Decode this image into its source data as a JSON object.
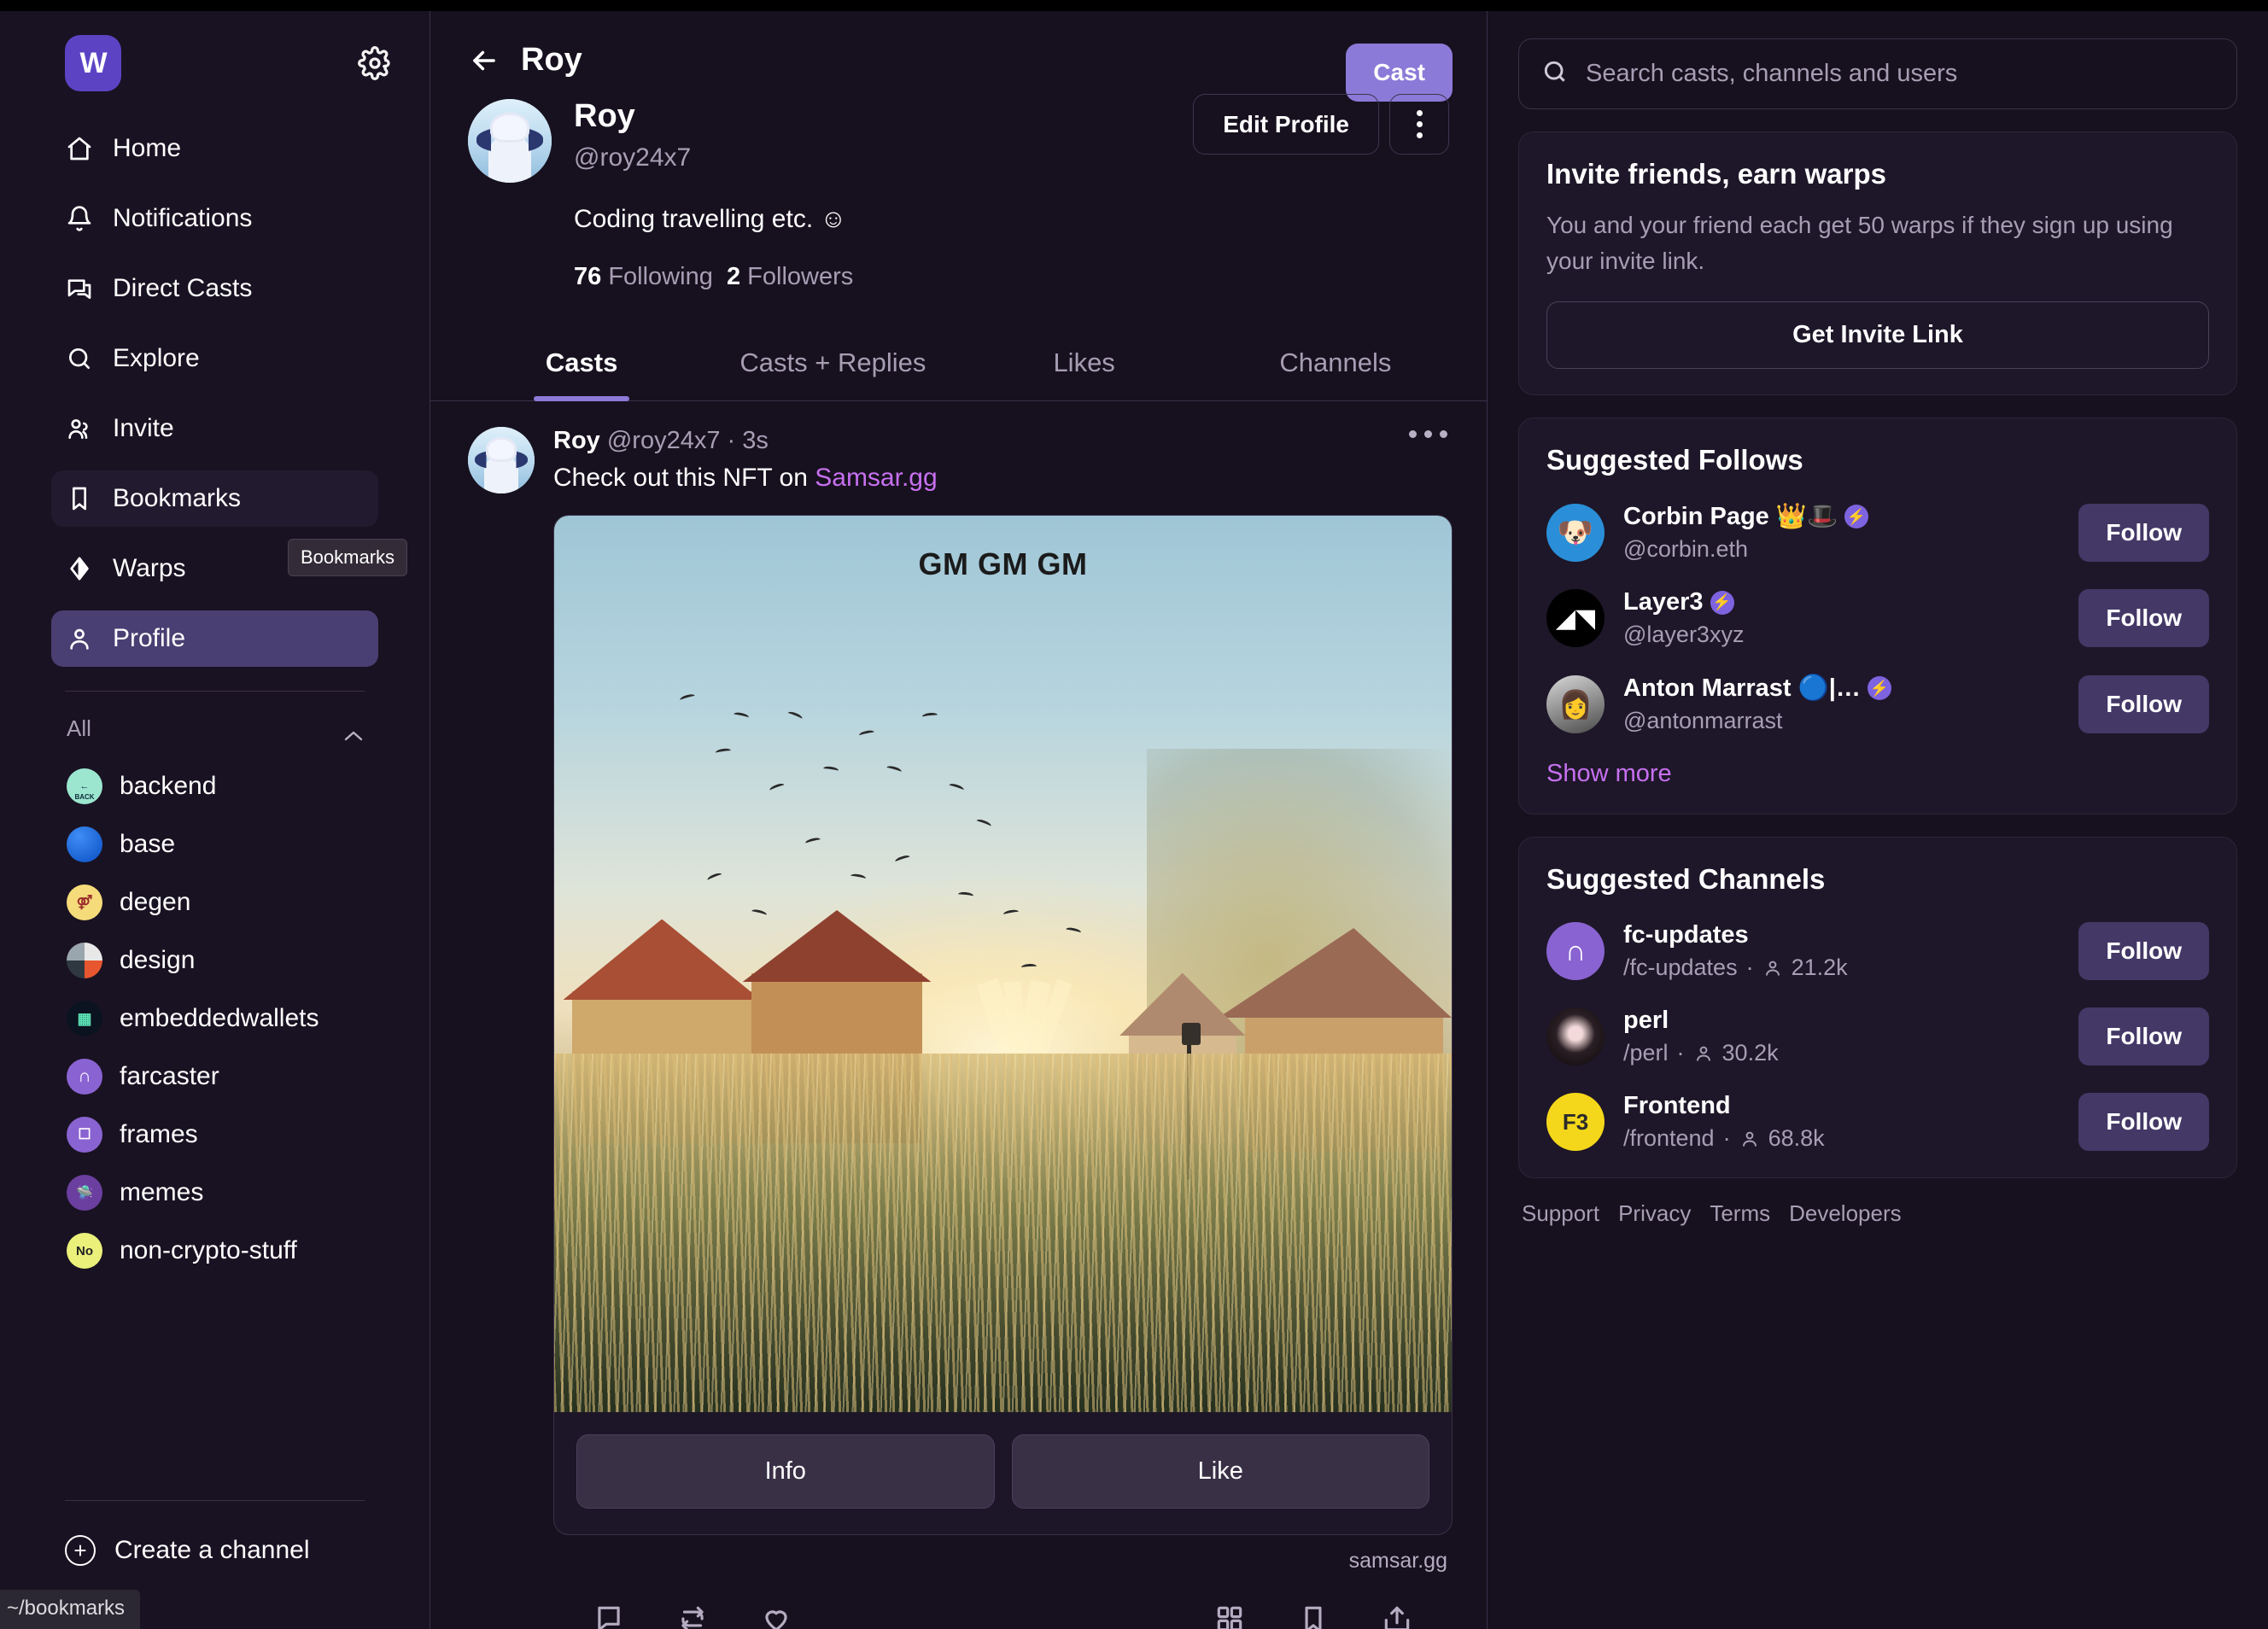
{
  "app": {
    "logo_letter": "W",
    "gear_icon": "gear-icon"
  },
  "sidebar": {
    "nav": [
      {
        "label": "Home",
        "icon": "home-icon",
        "state": "default"
      },
      {
        "label": "Notifications",
        "icon": "bell-icon",
        "state": "default"
      },
      {
        "label": "Direct Casts",
        "icon": "chat-icon",
        "state": "default"
      },
      {
        "label": "Explore",
        "icon": "search-icon",
        "state": "default"
      },
      {
        "label": "Invite",
        "icon": "users-icon",
        "state": "default"
      },
      {
        "label": "Bookmarks",
        "icon": "bookmark-icon",
        "state": "soft"
      },
      {
        "label": "Warps",
        "icon": "warp-diamond-icon",
        "state": "default"
      },
      {
        "label": "Profile",
        "icon": "person-icon",
        "state": "active"
      }
    ],
    "tooltip": "Bookmarks",
    "group_label": "All",
    "channels": [
      {
        "label": "backend",
        "avatar_text": "BACK",
        "avatar_color": "#9ce6cf",
        "text_color": "#124",
        "kind": "back-arrow"
      },
      {
        "label": "base",
        "avatar_text": "",
        "avatar_color": "#1164e0",
        "text_color": "#fff",
        "kind": "solid"
      },
      {
        "label": "degen",
        "avatar_text": "",
        "avatar_color": "#f5db7a",
        "text_color": "#333",
        "kind": "hat"
      },
      {
        "label": "design",
        "avatar_text": "",
        "avatar_color": "#d8d8d8",
        "text_color": "#333",
        "kind": "palette"
      },
      {
        "label": "embeddedwallets",
        "avatar_text": "",
        "avatar_color": "#0b1320",
        "text_color": "#7fe",
        "kind": "cube"
      },
      {
        "label": "farcaster",
        "avatar_text": "n",
        "avatar_color": "#8a63d2",
        "text_color": "#fff",
        "kind": "arch"
      },
      {
        "label": "frames",
        "avatar_text": "",
        "avatar_color": "#8a63d2",
        "text_color": "#fff",
        "kind": "square"
      },
      {
        "label": "memes",
        "avatar_text": "",
        "avatar_color": "#6b3fa0",
        "text_color": "#fff",
        "kind": "ufo"
      },
      {
        "label": "non-crypto-stuff",
        "avatar_text": "No",
        "avatar_color": "#eaf07a",
        "text_color": "#222",
        "kind": "text"
      }
    ],
    "create_channel": "Create a channel",
    "create_icon": "plus-circle-icon",
    "status_url": "~/bookmarks"
  },
  "center": {
    "header_title": "Roy",
    "back_icon": "back-arrow-icon",
    "cast_button": "Cast",
    "profile": {
      "display_name": "Roy",
      "handle": "@roy24x7",
      "bio": "Coding travelling etc. ☺",
      "following_count": "76",
      "following_label": "Following",
      "followers_count": "2",
      "followers_label": "Followers",
      "edit_button": "Edit Profile",
      "more_icon": "kebab-menu-icon"
    },
    "tabs": [
      {
        "label": "Casts",
        "active": true
      },
      {
        "label": "Casts + Replies",
        "active": false
      },
      {
        "label": "Likes",
        "active": false
      },
      {
        "label": "Channels",
        "active": false
      }
    ],
    "cast": {
      "author": "Roy",
      "handle": "@roy24x7",
      "separator": "·",
      "time": "3s",
      "text_before_link": "Check out this NFT on ",
      "link_text": "Samsar.gg",
      "more_icon": "ellipsis-icon",
      "frame": {
        "image_caption": "GM GM GM",
        "buttons": [
          "Info",
          "Like"
        ],
        "source": "samsar.gg"
      },
      "actions_left": [
        {
          "icon": "comment-icon"
        },
        {
          "icon": "recast-icon"
        },
        {
          "icon": "heart-icon"
        }
      ],
      "actions_right": [
        {
          "icon": "grid-icon"
        },
        {
          "icon": "bookmark-icon"
        },
        {
          "icon": "share-icon"
        }
      ]
    }
  },
  "right": {
    "search": {
      "placeholder": "Search casts, channels and users",
      "value": "",
      "icon": "search-icon"
    },
    "invite": {
      "title": "Invite friends, earn warps",
      "body": "You and your friend each get 50 warps if they sign up using your invite link.",
      "button": "Get Invite Link"
    },
    "suggested_follows": {
      "title": "Suggested Follows",
      "show_more": "Show more",
      "items": [
        {
          "name": "Corbin Page 👑🎩",
          "handle": "@corbin.eth",
          "verified": true,
          "button": "Follow",
          "avatar_color": "#2a8fd8",
          "avatar_glyph": "🐶"
        },
        {
          "name": "Layer3",
          "handle": "@layer3xyz",
          "verified": true,
          "button": "Follow",
          "avatar_color": "#000000",
          "avatar_glyph": "◧"
        },
        {
          "name": "Anton Marrast 🔵|…",
          "handle": "@antonmarrast",
          "verified": true,
          "button": "Follow",
          "avatar_color": "#d4d4d4",
          "avatar_glyph": "👩"
        }
      ]
    },
    "suggested_channels": {
      "title": "Suggested Channels",
      "items": [
        {
          "name": "fc-updates",
          "slug": "/fc-updates",
          "separator": "·",
          "members": "21.2k",
          "button": "Follow",
          "avatar_color": "#8a63d2",
          "avatar_glyph": "n"
        },
        {
          "name": "perl",
          "slug": "/perl",
          "separator": "·",
          "members": "30.2k",
          "button": "Follow",
          "avatar_color": "#151515",
          "avatar_glyph": "●"
        },
        {
          "name": "Frontend",
          "slug": "/frontend",
          "separator": "·",
          "members": "68.8k",
          "button": "Follow",
          "avatar_color": "#f4d71a",
          "avatar_glyph": "F3"
        }
      ]
    },
    "footer_links": [
      "Support",
      "Privacy",
      "Terms",
      "Developers"
    ]
  },
  "colors": {
    "accent": "#8b7ad8",
    "active_nav": "#4a3f72",
    "link": "#c770f0",
    "bg": "#17111f",
    "panel": "#1e1729",
    "border": "#3a3048"
  }
}
